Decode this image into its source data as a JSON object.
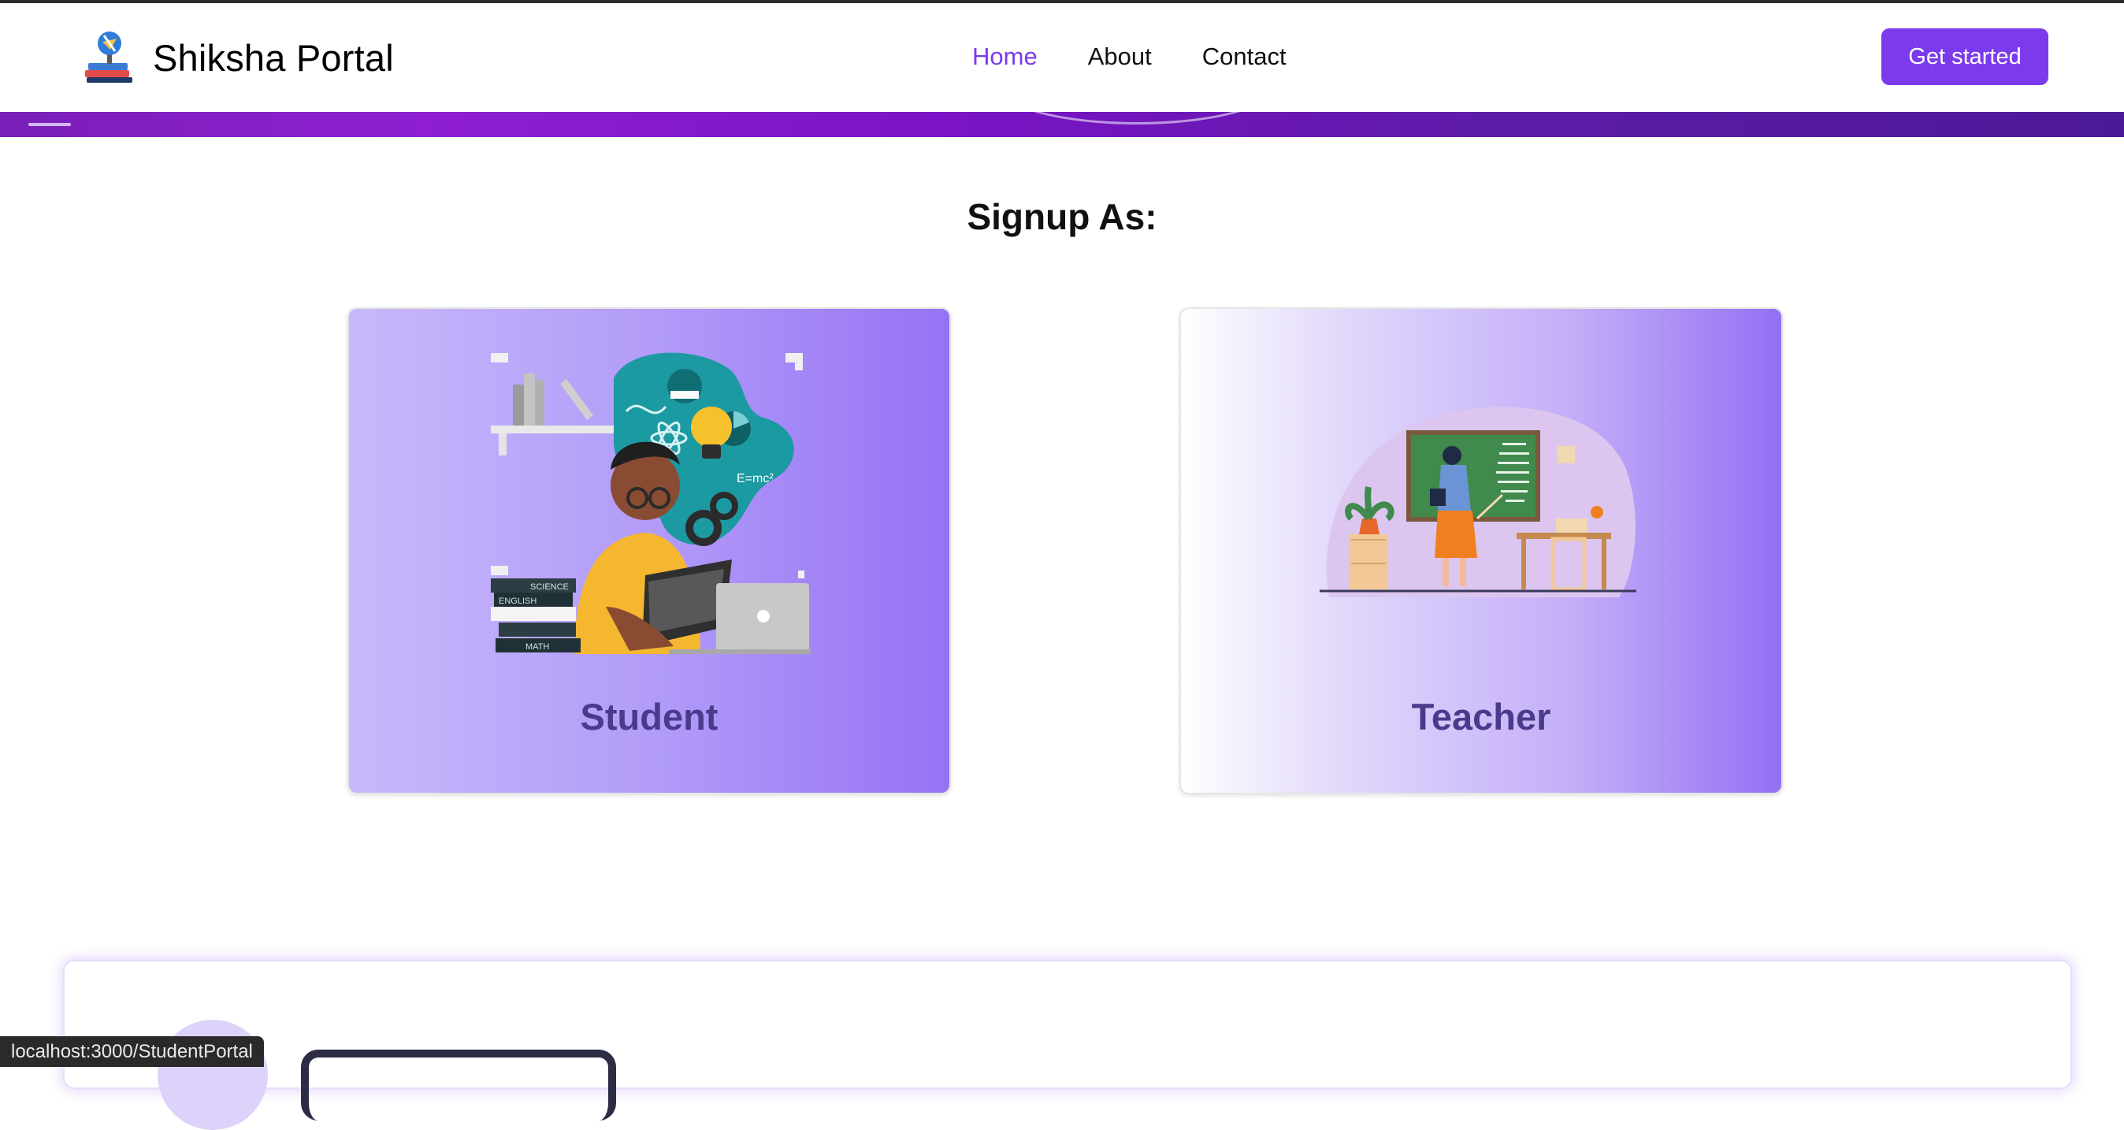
{
  "navbar": {
    "brand_name": "Shiksha Portal",
    "links": [
      {
        "label": "Home",
        "active": true
      },
      {
        "label": "About",
        "active": false
      },
      {
        "label": "Contact",
        "active": false
      }
    ],
    "cta_label": "Get started"
  },
  "main": {
    "heading": "Signup As:",
    "cards": [
      {
        "title": "Student"
      },
      {
        "title": "Teacher"
      }
    ],
    "student_illustration_text": {
      "book1": "SCIENCE",
      "book2": "ENGLISH",
      "book3": "MATH",
      "formula": "E=mc²"
    }
  },
  "status_url": "localhost:3000/StudentPortal",
  "colors": {
    "accent": "#7c3aed",
    "card_title": "#4a3a8c",
    "banner": "#7a14c5"
  }
}
